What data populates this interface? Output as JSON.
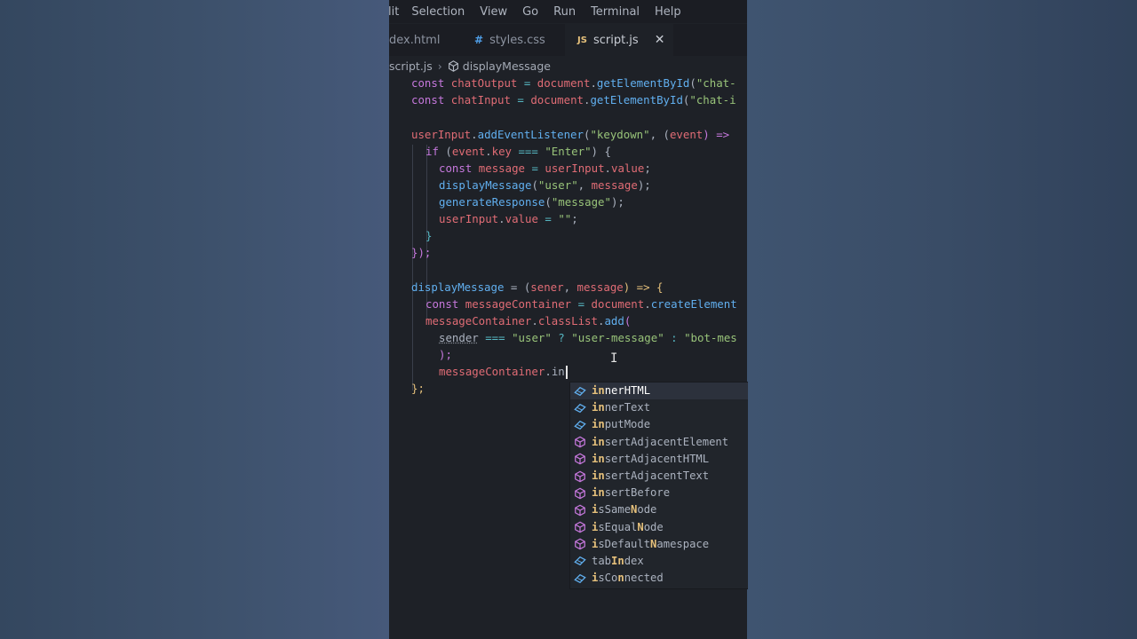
{
  "menu": [
    "lit",
    "Selection",
    "View",
    "Go",
    "Run",
    "Terminal",
    "Help"
  ],
  "tabs": [
    {
      "label": "dex.html",
      "icon": ""
    },
    {
      "label": "styles.css",
      "icon": "#"
    },
    {
      "label": "script.js",
      "icon": "JS",
      "close": "✕"
    }
  ],
  "breadcrumb": {
    "file": "script.js",
    "symbol": "displayMessage",
    "separator": "›"
  },
  "code": {
    "l1": [
      "const",
      " chatOutput",
      " = ",
      "document",
      ".",
      "getElementById",
      "(",
      "\"chat-"
    ],
    "l2": [
      "const",
      " chatInput",
      " = ",
      "document",
      ".",
      "getElementById",
      "(",
      "\"chat-i"
    ],
    "l3": [
      "userInput",
      ".",
      "addEventListener",
      "(",
      "\"keydown\"",
      ", (",
      "event",
      ") =>"
    ],
    "l4": [
      "if",
      " (",
      "event",
      ".",
      "key",
      " === ",
      "\"Enter\"",
      ") {"
    ],
    "l5": [
      "const",
      " message",
      " = ",
      "userInput",
      ".",
      "value",
      ";"
    ],
    "l6": [
      "displayMessage",
      "(",
      "\"user\"",
      ", ",
      "message",
      ");"
    ],
    "l7": [
      "generateResponse",
      "(",
      "\"message\"",
      ");"
    ],
    "l8": [
      "userInput",
      ".",
      "value",
      " = ",
      "\"\"",
      ";"
    ],
    "l9": "}",
    "l10": "});",
    "l11": [
      "displayMessage",
      " = (",
      "sener",
      ", ",
      "message",
      ") => {"
    ],
    "l12": [
      "const",
      " messageContainer",
      " = ",
      "document",
      ".",
      "createElement"
    ],
    "l13": [
      "messageContainer",
      ".",
      "classList",
      ".",
      "add",
      "("
    ],
    "l14": [
      "sender",
      " === ",
      "\"user\"",
      " ? ",
      "\"user-message\"",
      " : ",
      "\"bot-mes"
    ],
    "l15": ");",
    "l16": [
      "messageContainer",
      ".",
      "in"
    ],
    "l17": "};"
  },
  "suggestions": [
    {
      "pre": "",
      "hl": "in",
      "rest": "nerHTML",
      "kind": "property"
    },
    {
      "pre": "",
      "hl": "in",
      "rest": "nerText",
      "kind": "property"
    },
    {
      "pre": "",
      "hl": "in",
      "rest": "putMode",
      "kind": "property"
    },
    {
      "pre": "",
      "hl": "in",
      "rest": "sertAdjacentElement",
      "kind": "method"
    },
    {
      "pre": "",
      "hl": "in",
      "rest": "sertAdjacentHTML",
      "kind": "method"
    },
    {
      "pre": "",
      "hl": "in",
      "rest": "sertAdjacentText",
      "kind": "method"
    },
    {
      "pre": "",
      "hl": "in",
      "rest": "sertBefore",
      "kind": "method"
    },
    {
      "pre": "",
      "hl": "i",
      "rest": "sSame",
      "hl2": "N",
      "rest2": "ode",
      "kind": "method"
    },
    {
      "pre": "",
      "hl": "i",
      "rest": "sEqual",
      "hl2": "N",
      "rest2": "ode",
      "kind": "method"
    },
    {
      "pre": "",
      "hl": "i",
      "rest": "sDefault",
      "hl2": "N",
      "rest2": "amespace",
      "kind": "method"
    },
    {
      "pre": "tab",
      "hl": "In",
      "rest": "dex",
      "kind": "property"
    },
    {
      "pre": "",
      "hl": "i",
      "rest": "sCo",
      "hl2": "n",
      "rest2": "nected",
      "kind": "property"
    }
  ]
}
